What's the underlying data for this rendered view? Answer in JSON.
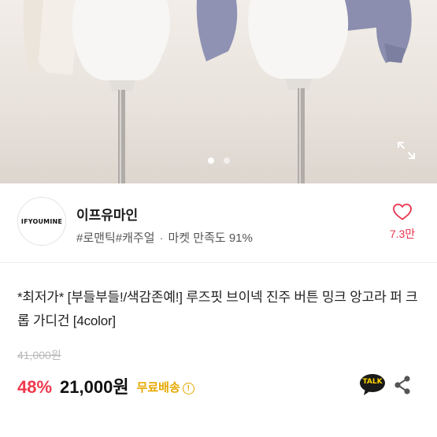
{
  "product_image": {
    "slide_count": 2,
    "active_slide": 1,
    "expand_icon": "expand-icon",
    "colors": {
      "cream": "#f3efe9",
      "lavender": "#8e91b0",
      "stand": "#a9a49f"
    }
  },
  "seller": {
    "logo_text": "IFYOUMINE",
    "name": "이프유마인",
    "tags": [
      "#로맨틱",
      "#캐주얼"
    ],
    "satisfaction_label": "마켓 만족도 91%",
    "wish_icon": "heart-outline-icon",
    "wish_count": "7.3만"
  },
  "product": {
    "title": "*최저가* [부들부들!/색감존예!] 루즈핏 브이넥 진주 버튼 밍크 앙고라 퍼 크롭 가디건 [4color]",
    "original_price": "41,000원",
    "discount": "48%",
    "price": "21,000원",
    "shipping": "무료배송",
    "shipping_info_icon": "info-icon",
    "talk_label": "TALK",
    "share_icon": "share-icon"
  },
  "colors": {
    "accent_red": "#f0384d",
    "shipping_yellow": "#e6a800",
    "kakao_black": "#1a1a1a",
    "kakao_yellow": "#ffd400"
  }
}
